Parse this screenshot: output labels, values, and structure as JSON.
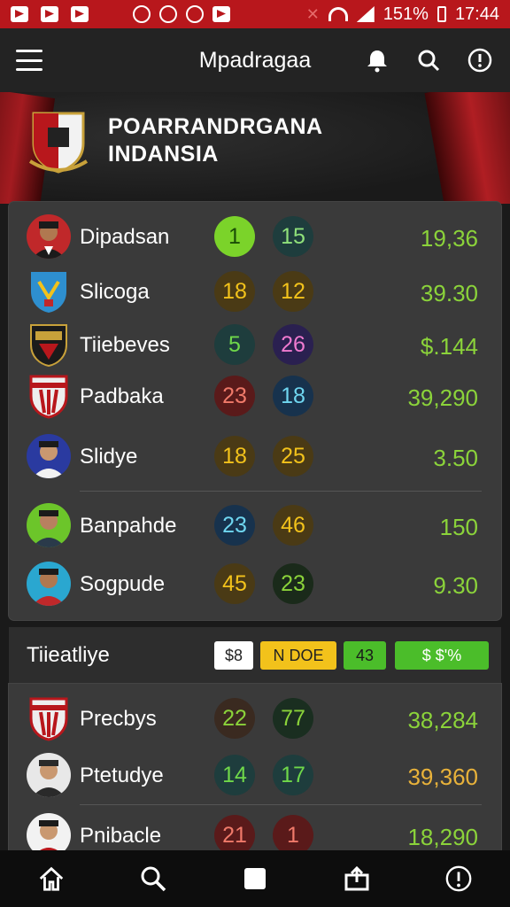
{
  "status_bar": {
    "battery": "151%",
    "time": "17:44"
  },
  "app_bar": {
    "title": "Mpadragaa"
  },
  "banner": {
    "line1": "POARRANDRGANA",
    "line2": "INDANSIA"
  },
  "table_main": {
    "rows": [
      {
        "name": "Dipadsan",
        "badge1": "1",
        "badge2": "15",
        "value": "19,36"
      },
      {
        "name": "Slicoga",
        "badge1": "18",
        "badge2": "12",
        "value": "39.30"
      },
      {
        "name": "Tiiebeves",
        "badge1": "5",
        "badge2": "26",
        "value": "$.144"
      },
      {
        "name": "Padbaka",
        "badge1": "23",
        "badge2": "18",
        "value": "39,290"
      },
      {
        "name": "Slidye",
        "badge1": "18",
        "badge2": "25",
        "value": "3.50"
      },
      {
        "name": "Banpahde",
        "badge1": "23",
        "badge2": "46",
        "value": "150"
      },
      {
        "name": "Sogpude",
        "badge1": "45",
        "badge2": "23",
        "value": "9.30"
      }
    ]
  },
  "section": {
    "title": "Tiieatliye",
    "chips": [
      "$8",
      "N DOE",
      "43",
      "$ $'%"
    ]
  },
  "table_secondary": {
    "rows": [
      {
        "name": "Precbys",
        "badge1": "22",
        "badge2": "77",
        "value": "38,284"
      },
      {
        "name": "Ptetudye",
        "badge1": "14",
        "badge2": "17",
        "value": "39,360"
      },
      {
        "name": "Pnibacle",
        "badge1": "21",
        "badge2": "1",
        "value": "18,290"
      }
    ]
  },
  "colors": {
    "status_bar": "#b8171c",
    "accent_green": "#8bd33a",
    "accent_yellow": "#f2c21b",
    "value_orange": "#e8b23a"
  },
  "icons": [
    "menu-icon",
    "bell-icon",
    "search-icon",
    "info-icon",
    "home-icon",
    "search-icon",
    "square-icon",
    "share-icon",
    "info-icon"
  ]
}
